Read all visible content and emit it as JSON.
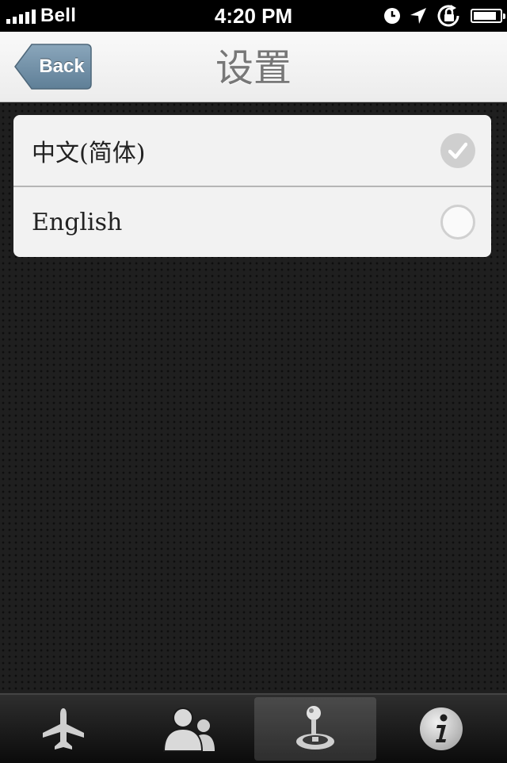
{
  "status_bar": {
    "carrier": "Bell",
    "time": "4:20 PM",
    "icons": [
      "signal-icon",
      "clock-icon",
      "location-icon",
      "rotation-lock-icon",
      "battery-icon"
    ],
    "battery_level": 0.9
  },
  "nav": {
    "title": "设置",
    "back_label": "Back"
  },
  "language_options": [
    {
      "label": "中文(简体)",
      "selected": true
    },
    {
      "label": "English",
      "selected": false
    }
  ],
  "tabs": [
    {
      "icon": "airplane-icon",
      "selected": false
    },
    {
      "icon": "people-icon",
      "selected": false
    },
    {
      "icon": "joystick-icon",
      "selected": true
    },
    {
      "icon": "info-icon",
      "selected": false
    }
  ],
  "colors": {
    "back_button": "#6d8ca3",
    "nav_title": "#777777",
    "background": "#1f1f1f"
  }
}
